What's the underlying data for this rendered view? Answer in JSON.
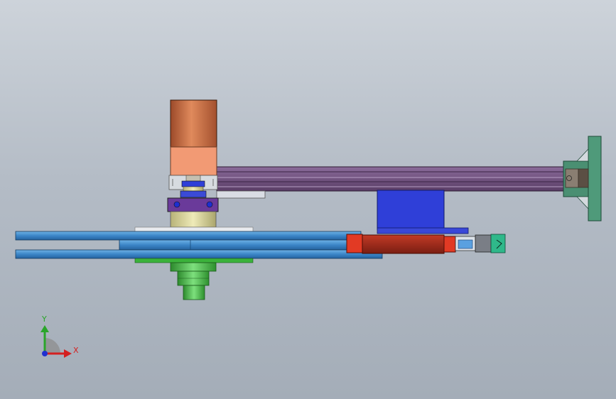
{
  "triad": {
    "x_label": "X",
    "y_label": "Y"
  },
  "colors": {
    "background_top": "#cdd3da",
    "background_bottom": "#a4adb8",
    "motor_copper": "#c86a42",
    "motor_mount": "#f29a74",
    "beam_purple": "#6b4b78",
    "wall_plate_green": "#4a8f72",
    "slide_block_blue": "#2f3fd8",
    "belt_blue": "#3f8cd0",
    "gearbox_red": "#a8301e",
    "shaft_green": "#3bb23b",
    "axis_x": "#d42020",
    "axis_y": "#2aa52a",
    "axis_z": "#2030d0"
  }
}
